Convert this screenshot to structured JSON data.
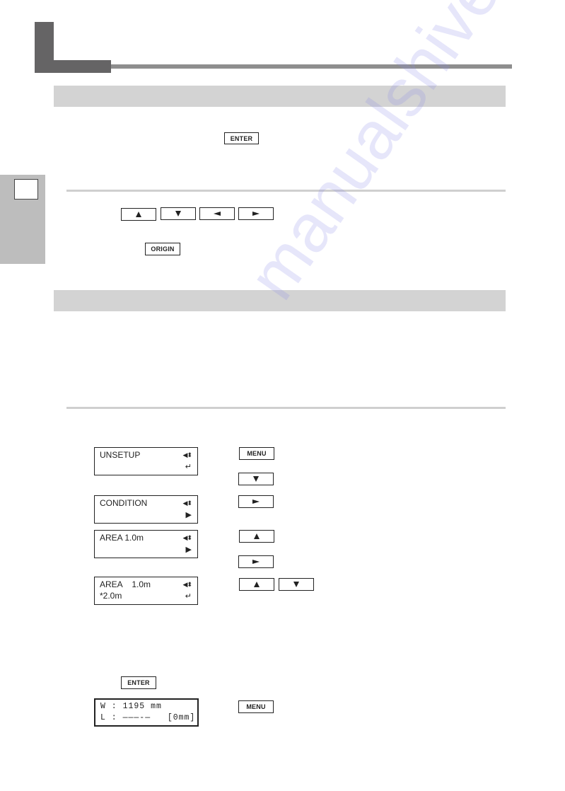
{
  "page": {
    "chapter_marker": "chapter-header-block",
    "side_tab": {
      "label": ""
    },
    "sections": [
      {
        "heading": ""
      },
      {
        "heading": ""
      }
    ]
  },
  "keys": {
    "enter": "ENTER",
    "origin": "ORIGIN",
    "menu": "MENU",
    "up": "up-arrow-key",
    "down": "down-arrow-key",
    "left": "left-arrow-key",
    "right": "right-arrow-key"
  },
  "lcd_panels": [
    {
      "line1": "UNSETUP",
      "line2": "",
      "indicator_top": "◀⬍",
      "indicator_bottom": "↵"
    },
    {
      "line1": "CONDITION",
      "line2": "",
      "indicator_top": "◀⬍",
      "indicator_bottom": "▶"
    },
    {
      "line1": "AREA 1.0m",
      "line2": "",
      "indicator_top": "◀⬍",
      "indicator_bottom": "▶"
    },
    {
      "line1": "AREA    1.0m",
      "line2": "*2.0m",
      "indicator_top": "◀⬍",
      "indicator_bottom": "↵"
    },
    {
      "line1": "W : 1195 mm",
      "line2": "L : ———-—   [0mm]"
    }
  ],
  "watermark": "manualshive.com",
  "colors": {
    "chapter_block": "#656465",
    "chapter_rule": "#8e8e8e",
    "section_band": "#d3d3d3",
    "side_tab": "#bdbdbd",
    "divider": "#cfcfcf"
  }
}
